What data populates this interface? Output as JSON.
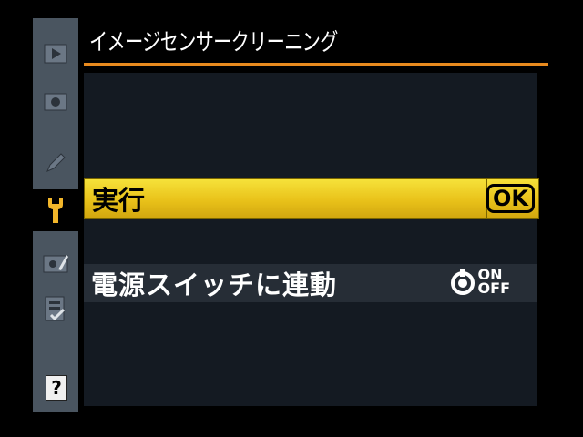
{
  "screen": {
    "title": "イメージセンサークリーニング"
  },
  "menu": {
    "items": [
      {
        "label": "実行",
        "control": "OK"
      },
      {
        "label": "電源スイッチに連動",
        "control": {
          "on": "ON",
          "off": "OFF"
        }
      }
    ]
  },
  "sidebar": {
    "tabs": [
      {
        "icon": "playback-icon",
        "active": false
      },
      {
        "icon": "camera-icon",
        "active": false
      },
      {
        "icon": "pencil-icon",
        "active": false
      },
      {
        "icon": "wrench-icon",
        "active": true
      },
      {
        "icon": "retouch-icon",
        "active": false
      },
      {
        "icon": "my-menu-icon",
        "active": false
      }
    ],
    "help_label": "?"
  },
  "colors": {
    "accent_orange": "#e88a1e",
    "highlight_yellow": "#f0d02a",
    "sidebar_gray": "#4a5560",
    "panel_dark": "#141a22"
  }
}
